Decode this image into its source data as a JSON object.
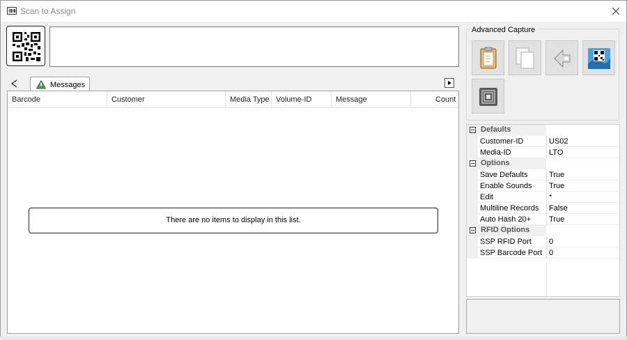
{
  "window": {
    "title": "Scan to Assign"
  },
  "icons": {
    "title": "barcode-scanner-icon",
    "close": "close-icon",
    "scan": "qr-code-icon",
    "tab": "messages-icon",
    "nav_left": "chevron-left-icon",
    "nav_right": "chevron-right-icon",
    "capture": [
      "clipboard-icon",
      "copy-pages-icon",
      "back-arrow-icon",
      "qr-image-icon",
      "rfid-chip-icon"
    ]
  },
  "scan_input": {
    "value": ""
  },
  "tabs": [
    {
      "label": "Messages"
    }
  ],
  "list": {
    "columns": [
      "Barcode",
      "Customer",
      "Media Type",
      "Volume-ID",
      "Message",
      "Count"
    ],
    "empty_text": "There are no items to display in this list."
  },
  "advanced_capture": {
    "title": "Advanced Capture"
  },
  "properties": {
    "categories": [
      {
        "name": "Defaults",
        "props": [
          {
            "name": "Customer-ID",
            "value": "US02"
          },
          {
            "name": "Media-ID",
            "value": "LTO"
          }
        ]
      },
      {
        "name": "Options",
        "props": [
          {
            "name": "Save Defaults",
            "value": "True"
          },
          {
            "name": "Enable Sounds",
            "value": "True"
          },
          {
            "name": "Edit",
            "value": "*"
          },
          {
            "name": "Multiline Records",
            "value": "False"
          },
          {
            "name": "Auto Hash 20+",
            "value": "True"
          }
        ]
      },
      {
        "name": "RFID Options",
        "props": [
          {
            "name": "SSP RFID Port",
            "value": "0"
          },
          {
            "name": "SSP Barcode Port",
            "value": "0"
          }
        ]
      }
    ]
  },
  "colors": {
    "window_bg": "#f0f0f0",
    "border": "#a0a0a0",
    "button_bg": "#e1e1e1"
  }
}
